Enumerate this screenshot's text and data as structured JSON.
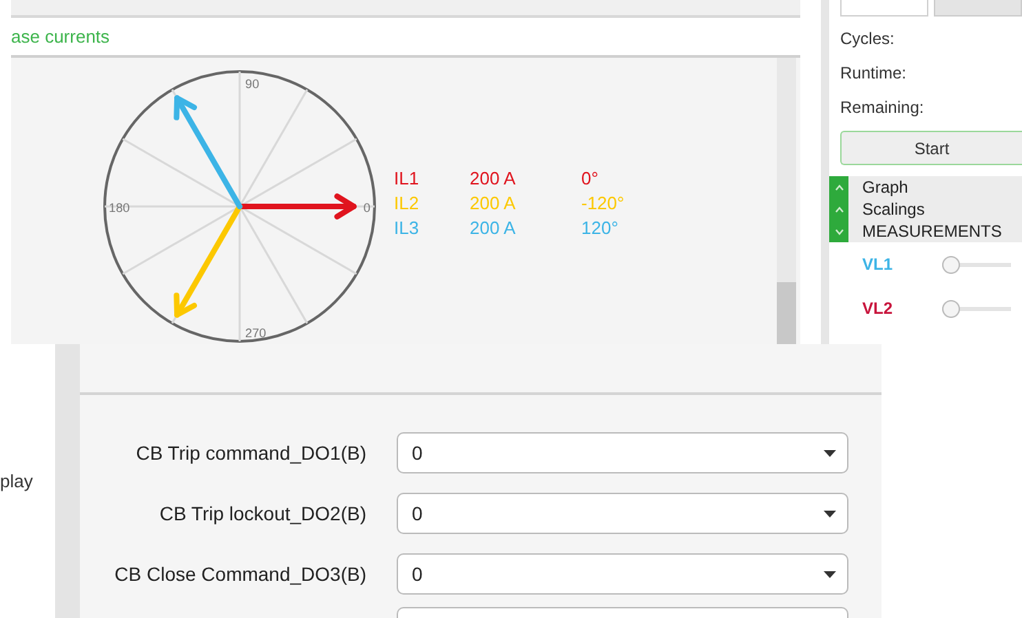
{
  "phasor_panel": {
    "title": "ase currents",
    "axis_labels": [
      "90",
      "180",
      "0",
      "270"
    ],
    "phasors": [
      {
        "name": "IL1",
        "magnitude": "200 A",
        "angle": "0°",
        "color": "#e0141e"
      },
      {
        "name": "IL2",
        "magnitude": "200 A",
        "angle": "-120°",
        "color": "#fcc800"
      },
      {
        "name": "IL3",
        "magnitude": "200 A",
        "angle": "120°",
        "color": "#3cb4e6"
      }
    ]
  },
  "test_panel": {
    "tabs": [
      {
        "selected": true
      },
      {
        "selected": false
      }
    ],
    "fields": [
      "Cycles:",
      "Runtime:",
      "Remaining:"
    ],
    "start_button": "Start",
    "sections": [
      {
        "label": "Graph",
        "expanded": false
      },
      {
        "label": "Scalings",
        "expanded": false
      },
      {
        "label": "MEASUREMENTS",
        "expanded": true
      }
    ],
    "measurements": [
      {
        "name": "VL1",
        "color": "#3cb4e6",
        "level": 0
      },
      {
        "name": "VL2",
        "color": "#c8143c",
        "level": 0
      }
    ]
  },
  "side_label": "play",
  "output_settings": [
    {
      "label": "CB Trip command_DO1(B)",
      "value": "0"
    },
    {
      "label": "CB Trip lockout_DO2(B)",
      "value": "0"
    },
    {
      "label": "CB Close Command_DO3(B)",
      "value": "0"
    }
  ]
}
